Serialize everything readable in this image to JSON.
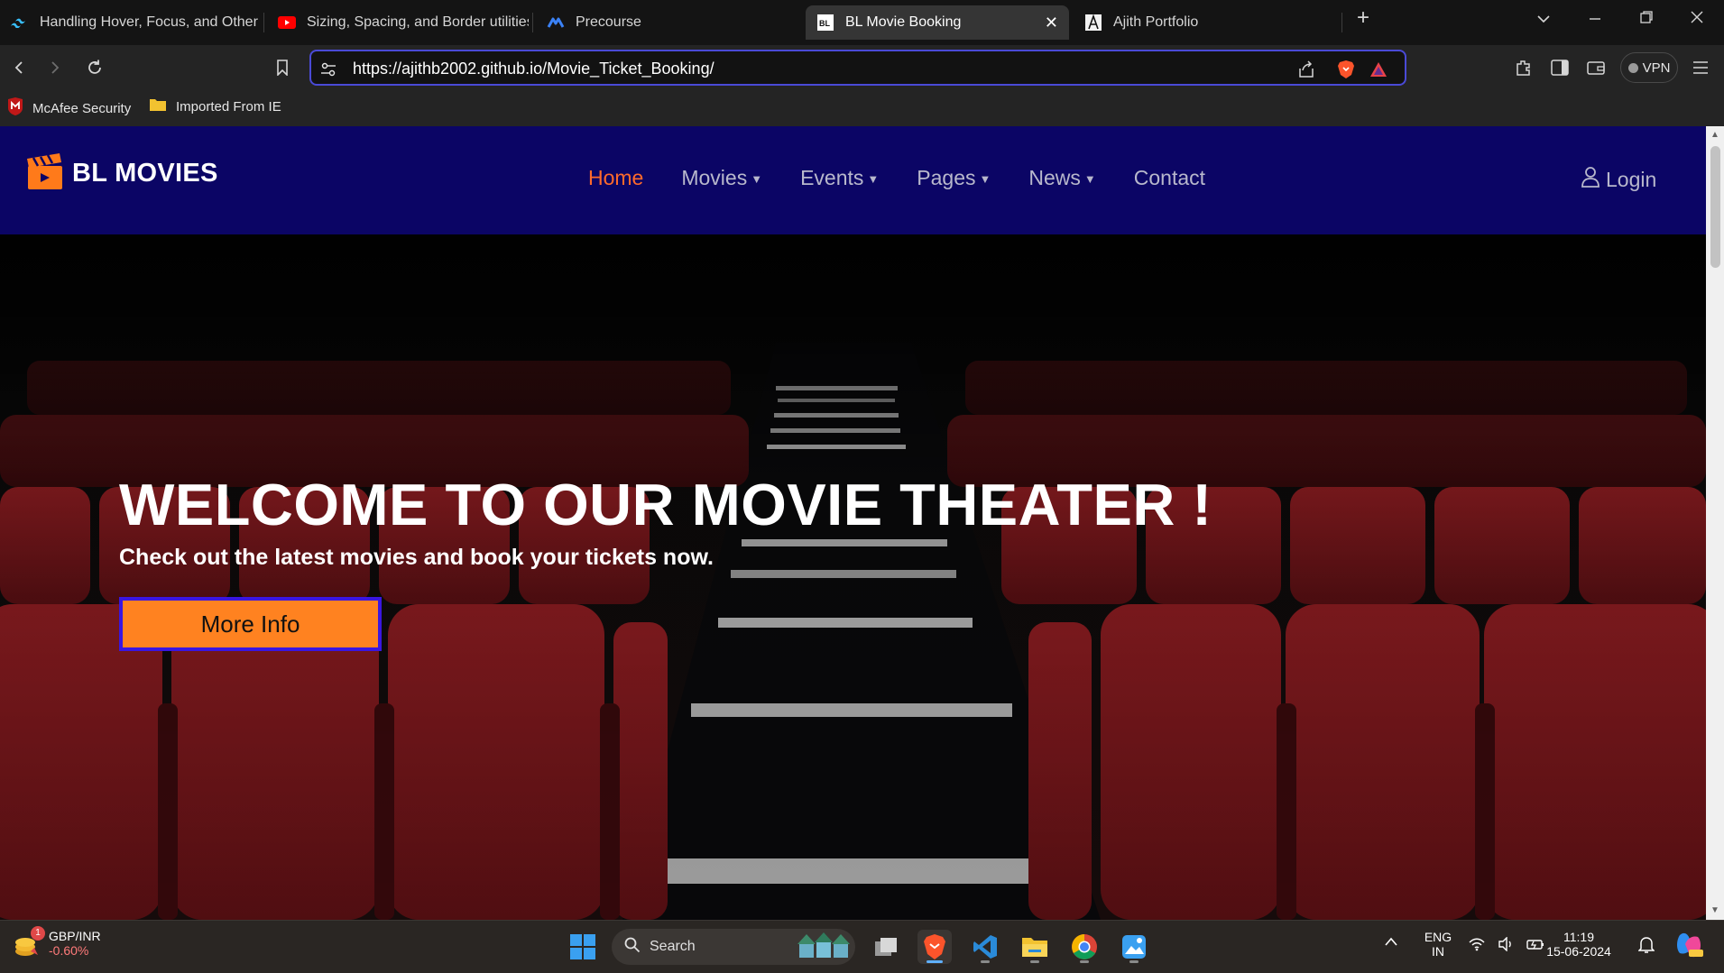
{
  "browser": {
    "tabs": [
      {
        "title": "Handling Hover, Focus, and Other St",
        "icon": "tailwind-icon",
        "active": false
      },
      {
        "title": "Sizing, Spacing, and Border utilities T",
        "icon": "youtube-icon",
        "active": false
      },
      {
        "title": "Precourse",
        "icon": "precourse-icon",
        "active": false
      },
      {
        "title": "BL Movie Booking",
        "icon": "bl-icon",
        "active": true
      },
      {
        "title": "Ajith Portfolio",
        "icon": "portfolio-icon",
        "active": false
      }
    ],
    "url": "https://ajithb2002.github.io/Movie_Ticket_Booking/",
    "vpn_label": "VPN",
    "bookmarks": [
      {
        "label": "McAfee Security",
        "icon": "mcafee-icon"
      },
      {
        "label": "Imported From IE",
        "icon": "folder-icon"
      }
    ]
  },
  "site": {
    "brand": "BL MOVIES",
    "nav": [
      {
        "label": "Home",
        "active": true,
        "dropdown": false
      },
      {
        "label": "Movies",
        "active": false,
        "dropdown": true
      },
      {
        "label": "Events",
        "active": false,
        "dropdown": true
      },
      {
        "label": "Pages",
        "active": false,
        "dropdown": true
      },
      {
        "label": "News",
        "active": false,
        "dropdown": true
      },
      {
        "label": "Contact",
        "active": false,
        "dropdown": false
      }
    ],
    "login": "Login",
    "hero": {
      "title": "WELCOME TO OUR MOVIE THEATER !",
      "subtitle": "Check out the latest movies and book your tickets now.",
      "button": "More Info"
    },
    "colors": {
      "nav_bg": "#0b0565",
      "active_link": "#ff6a2b",
      "button": "#ff8220",
      "button_border": "#3a16e0"
    }
  },
  "taskbar": {
    "widget": {
      "title": "GBP/INR",
      "change": "-0.60%",
      "badge": "1"
    },
    "search_placeholder": "Search",
    "lang_line1": "ENG",
    "lang_line2": "IN",
    "time": "11:19",
    "date": "15-06-2024"
  }
}
